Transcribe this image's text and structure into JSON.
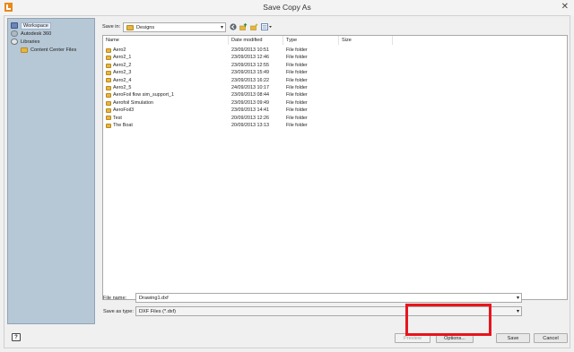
{
  "window": {
    "title": "Save Copy As",
    "close_glyph": "✕"
  },
  "sidebar": {
    "items": [
      {
        "label": "Workspace",
        "icon": "workspace-icon"
      },
      {
        "label": "Autodesk 360",
        "icon": "autodesk-360-icon"
      },
      {
        "label": "Libraries",
        "icon": "libraries-icon"
      },
      {
        "label": "Content Center Files",
        "icon": "folder-icon"
      }
    ]
  },
  "toolbar": {
    "save_in_label": "Save in:",
    "save_in_value": "Designs"
  },
  "columns": [
    "Name",
    "Date modified",
    "Type",
    "Size"
  ],
  "files": [
    {
      "name": "Aero2",
      "date": "23/09/2013 10:51",
      "type": "File folder"
    },
    {
      "name": "Aero2_1",
      "date": "23/09/2013 12:46",
      "type": "File folder"
    },
    {
      "name": "Aero2_2",
      "date": "23/09/2013 12:55",
      "type": "File folder"
    },
    {
      "name": "Aero2_3",
      "date": "23/09/2013 15:49",
      "type": "File folder"
    },
    {
      "name": "Aero2_4",
      "date": "23/09/2013 16:22",
      "type": "File folder"
    },
    {
      "name": "Aero2_5",
      "date": "24/09/2013 10:17",
      "type": "File folder"
    },
    {
      "name": "AeroFoil flow sim_support_1",
      "date": "23/09/2013 08:44",
      "type": "File folder"
    },
    {
      "name": "Aerofoil Simulation",
      "date": "23/09/2013 09:49",
      "type": "File folder"
    },
    {
      "name": "AeroFoil3",
      "date": "23/09/2013 14:41",
      "type": "File folder"
    },
    {
      "name": "Test",
      "date": "20/09/2013 12:26",
      "type": "File folder"
    },
    {
      "name": "The Boat",
      "date": "20/09/2013 13:13",
      "type": "File folder"
    }
  ],
  "form": {
    "file_name_label": "File name:",
    "file_name_value": "Drawing1.dxf",
    "save_type_label": "Save as type:",
    "save_type_value": "DXF Files (*.dxf)"
  },
  "buttons": {
    "help": "?",
    "preview": "Preview",
    "options": "Options...",
    "save": "Save",
    "cancel": "Cancel"
  },
  "colors": {
    "highlight": "#e8141c",
    "sidebar": "#b6c7d5",
    "folder": "#e7b640"
  }
}
